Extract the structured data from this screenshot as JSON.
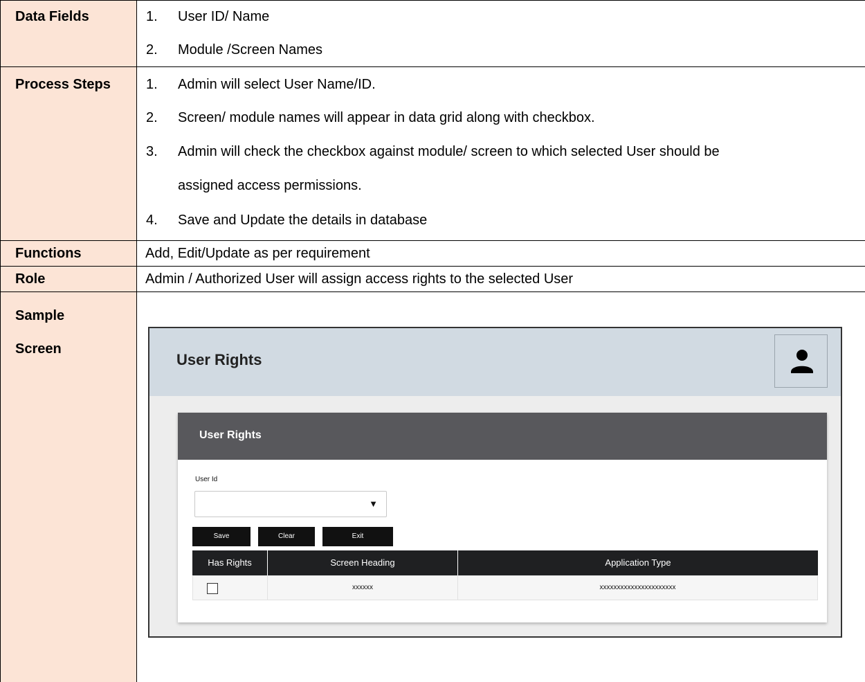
{
  "rows": {
    "data_fields": {
      "label": "Data Fields",
      "items": [
        {
          "num": "1.",
          "text": "User ID/ Name"
        },
        {
          "num": "2.",
          "text": "Module /Screen Names"
        }
      ]
    },
    "process_steps": {
      "label": "Process Steps",
      "items": [
        {
          "num": "1.",
          "text": "Admin will select User Name/ID."
        },
        {
          "num": "2.",
          "text": "Screen/ module names will appear in data grid along with checkbox."
        },
        {
          "num": "3.",
          "text": "Admin will check the checkbox against module/ screen to which selected User should be",
          "continuation": "assigned access permissions."
        },
        {
          "num": "4.",
          "text": "Save and Update the details in database"
        }
      ]
    },
    "functions": {
      "label": "Functions",
      "value": "Add, Edit/Update as per requirement"
    },
    "role": {
      "label": "Role",
      "value": "Admin / Authorized User will assign access rights to the selected User"
    },
    "sample_screen": {
      "label_line1": "Sample",
      "label_line2": "Screen"
    }
  },
  "mock": {
    "app_title": "User Rights",
    "avatar_icon": "user-icon",
    "card_title": "User Rights",
    "user_id_label": "User Id",
    "user_id_value": "",
    "select_arrow": "▼",
    "buttons": {
      "save": "Save",
      "clear": "Clear",
      "exit": "Exit"
    },
    "grid": {
      "headers": [
        "Has Rights",
        "Screen Heading",
        "Application Type"
      ],
      "row": {
        "has_rights": false,
        "screen_heading": "xxxxxx",
        "application_type": "xxxxxxxxxxxxxxxxxxxxxx"
      }
    },
    "colors": {
      "label_bg": "#fce4d6",
      "header_bg": "#d1dae2",
      "card_head_bg": "#58585c",
      "grid_head_bg": "#1f2022",
      "button_bg": "#111111"
    }
  }
}
